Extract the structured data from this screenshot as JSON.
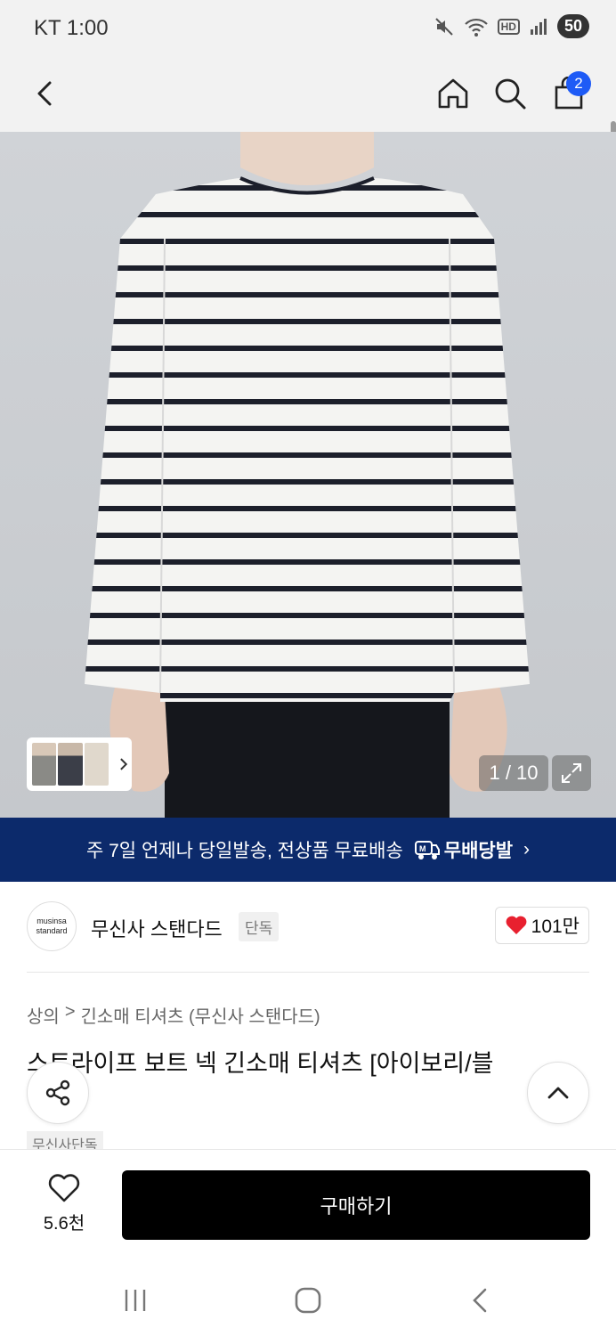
{
  "status_bar": {
    "carrier_time": "KT 1:00",
    "battery": "50",
    "hd_label": "HD"
  },
  "nav": {
    "back": "back",
    "home": "home",
    "search": "search",
    "cart_count": "2"
  },
  "gallery": {
    "page_counter": "1 / 10"
  },
  "promo_banner": {
    "text": "주 7일 언제나 당일발송, 전상품 무료배송",
    "badge": "무배당발",
    "arrow": "›"
  },
  "brand": {
    "logo_line1": "musinsa",
    "logo_line2": "standard",
    "name": "무신사 스탠다드",
    "tag": "단독",
    "likes": "101만"
  },
  "breadcrumb": {
    "category": "상의",
    "separator": ">",
    "subcategory": "긴소매 티셔츠 (무신사 스탠다드)"
  },
  "product": {
    "title": "스트라이프 보트 넥 긴소매 티셔츠 [아이보리/블",
    "tag": "무신사단독"
  },
  "bottom": {
    "wish_count": "5.6천",
    "buy_label": "구매하기"
  },
  "colors": {
    "promo_bg": "#0c2a6b",
    "cart_badge": "#1e5bf6",
    "heart": "#e8202f",
    "buy_bg": "#000000"
  }
}
